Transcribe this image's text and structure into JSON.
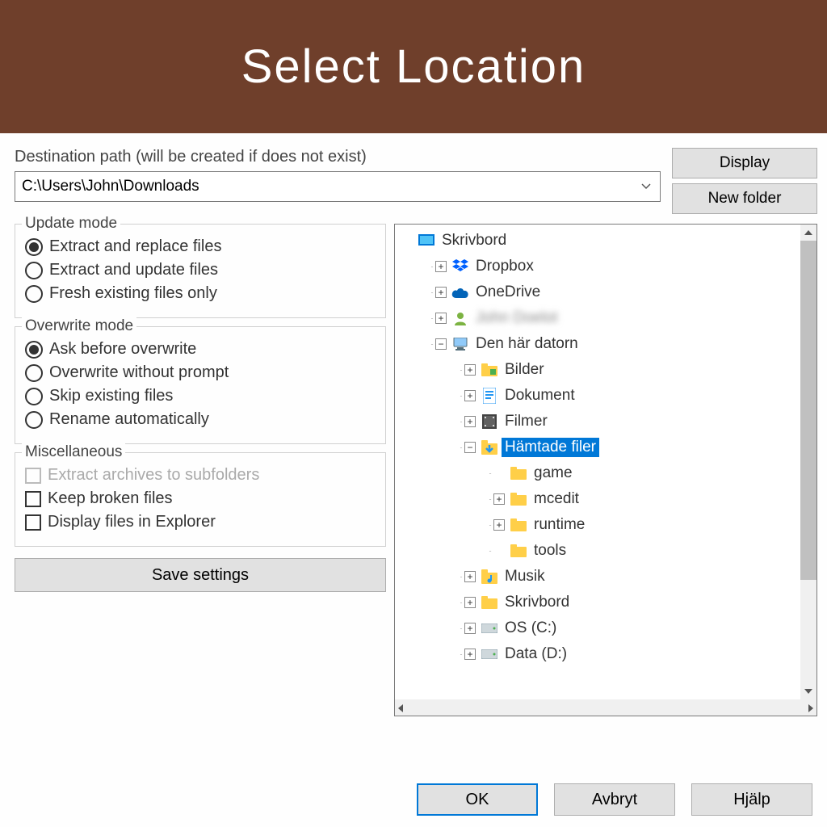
{
  "banner": {
    "title": "Select Location"
  },
  "path": {
    "label": "Destination path (will be created if does not exist)",
    "value": "C:\\Users\\John\\Downloads"
  },
  "buttons": {
    "display": "Display",
    "new_folder": "New folder",
    "save_settings": "Save settings",
    "ok": "OK",
    "cancel": "Avbryt",
    "help": "Hjälp"
  },
  "groups": {
    "update": {
      "title": "Update mode",
      "options": [
        {
          "label": "Extract and replace files",
          "checked": true
        },
        {
          "label": "Extract and update files",
          "checked": false
        },
        {
          "label": "Fresh existing files only",
          "checked": false
        }
      ]
    },
    "overwrite": {
      "title": "Overwrite mode",
      "options": [
        {
          "label": "Ask before overwrite",
          "checked": true
        },
        {
          "label": "Overwrite without prompt",
          "checked": false
        },
        {
          "label": "Skip existing files",
          "checked": false
        },
        {
          "label": "Rename automatically",
          "checked": false
        }
      ]
    },
    "misc": {
      "title": "Miscellaneous",
      "options": [
        {
          "label": "Extract archives to subfolders",
          "checked": false,
          "disabled": true
        },
        {
          "label": "Keep broken files",
          "checked": false,
          "disabled": false
        },
        {
          "label": "Display files in Explorer",
          "checked": false,
          "disabled": false
        }
      ]
    }
  },
  "tree": {
    "items": [
      {
        "indent": 0,
        "expander": "",
        "icon": "desktop",
        "label": "Skrivbord",
        "selected": false
      },
      {
        "indent": 1,
        "expander": "+",
        "icon": "dropbox",
        "label": "Dropbox"
      },
      {
        "indent": 1,
        "expander": "+",
        "icon": "onedrive",
        "label": "OneDrive"
      },
      {
        "indent": 1,
        "expander": "+",
        "icon": "user",
        "label": "",
        "blurred": true
      },
      {
        "indent": 1,
        "expander": "-",
        "icon": "computer",
        "label": "Den här datorn"
      },
      {
        "indent": 2,
        "expander": "+",
        "icon": "pictures",
        "label": "Bilder"
      },
      {
        "indent": 2,
        "expander": "+",
        "icon": "documents",
        "label": "Dokument"
      },
      {
        "indent": 2,
        "expander": "+",
        "icon": "videos",
        "label": "Filmer"
      },
      {
        "indent": 2,
        "expander": "-",
        "icon": "downloads",
        "label": "Hämtade filer",
        "selected": true
      },
      {
        "indent": 3,
        "expander": "",
        "icon": "folder",
        "label": "game"
      },
      {
        "indent": 3,
        "expander": "+",
        "icon": "folder",
        "label": "mcedit"
      },
      {
        "indent": 3,
        "expander": "+",
        "icon": "folder",
        "label": "runtime"
      },
      {
        "indent": 3,
        "expander": "",
        "icon": "folder",
        "label": "tools"
      },
      {
        "indent": 2,
        "expander": "+",
        "icon": "music",
        "label": "Musik"
      },
      {
        "indent": 2,
        "expander": "+",
        "icon": "folder",
        "label": "Skrivbord"
      },
      {
        "indent": 2,
        "expander": "+",
        "icon": "drive",
        "label": "OS (C:)"
      },
      {
        "indent": 2,
        "expander": "+",
        "icon": "drive",
        "label": "Data (D:)"
      }
    ]
  }
}
